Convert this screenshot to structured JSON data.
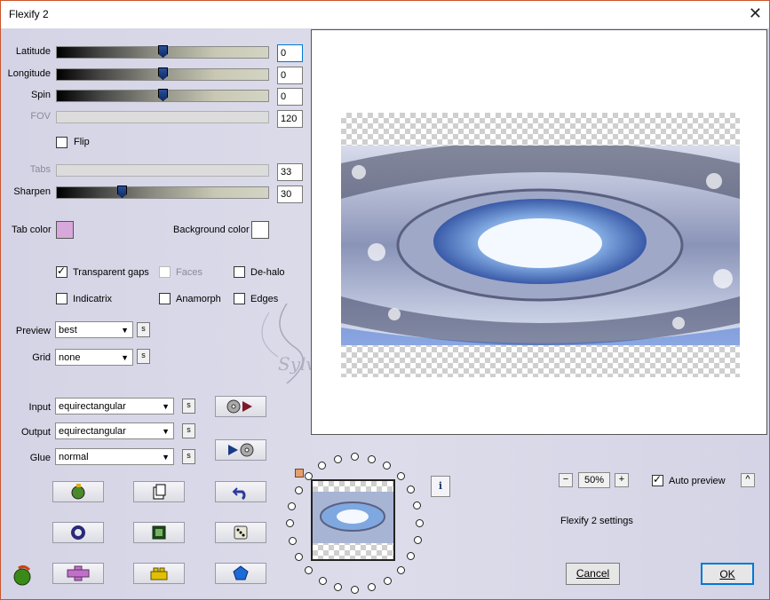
{
  "window": {
    "title": "Flexify 2",
    "close_glyph": "✕"
  },
  "sliders": [
    {
      "label": "Latitude",
      "value": "0",
      "thumb_fraction": 0.5,
      "enabled": true
    },
    {
      "label": "Longitude",
      "value": "0",
      "thumb_fraction": 0.5,
      "enabled": true
    },
    {
      "label": "Spin",
      "value": "0",
      "thumb_fraction": 0.5,
      "enabled": true
    },
    {
      "label": "FOV",
      "value": "120",
      "enabled": false
    },
    {
      "label": "Tabs",
      "value": "33",
      "enabled": false
    },
    {
      "label": "Sharpen",
      "value": "30",
      "thumb_fraction": 0.3,
      "enabled": true
    }
  ],
  "flip": {
    "label": "Flip",
    "checked": false
  },
  "tab_color": {
    "label": "Tab color",
    "color": "#d8a8dc"
  },
  "background_color": {
    "label": "Background color",
    "color": "#ffffff"
  },
  "options": {
    "transparent_gaps": {
      "label": "Transparent gaps",
      "checked": true
    },
    "faces": {
      "label": "Faces",
      "checked": false,
      "enabled": false
    },
    "de_halo": {
      "label": "De-halo",
      "checked": false
    },
    "indicatrix": {
      "label": "Indicatrix",
      "checked": false
    },
    "anamorph": {
      "label": "Anamorph",
      "checked": false
    },
    "edges": {
      "label": "Edges",
      "checked": false
    }
  },
  "preview_select": {
    "label": "Preview",
    "value": "best"
  },
  "grid_select": {
    "label": "Grid",
    "value": "none"
  },
  "input_select": {
    "label": "Input",
    "value": "equirectangular"
  },
  "output_select": {
    "label": "Output",
    "value": "equirectangular"
  },
  "glue_select": {
    "label": "Glue",
    "value": "normal"
  },
  "s_button_label": "s",
  "zoom": {
    "minus": "−",
    "value": "50%",
    "plus": "+"
  },
  "auto_preview": {
    "label": "Auto preview",
    "checked": true
  },
  "collapse_glyph": "^",
  "info_glyph": "i",
  "settings_label": "Flexify 2 settings",
  "watermark": "Sylviane",
  "buttons": {
    "cancel": "Cancel",
    "ok": "OK"
  },
  "colors": {
    "accent": "#0078d7",
    "dialog_bg": "#d7d7e6",
    "title_border": "#c9552c"
  }
}
